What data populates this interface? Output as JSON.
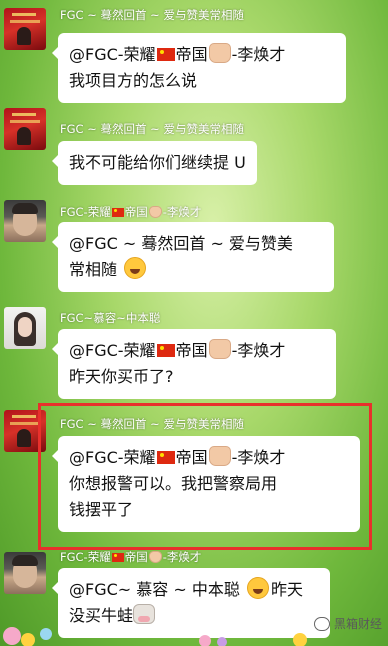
{
  "messages": [
    {
      "sender": "FGC ~ 蓦然回首 ~ 爱与赞美常相随",
      "lines": [
        "@FGC-荣耀",
        "帝国",
        "-李焕才",
        "我项目方的怎么说"
      ]
    },
    {
      "sender": "FGC ~ 蓦然回首 ~ 爱与赞美常相随",
      "text": "我不可能给你们继续提 U"
    },
    {
      "sender_a": "FGC-荣耀",
      "sender_b": "帝国",
      "sender_c": "-李焕才",
      "lines": [
        "@FGC ~ 蓦然回首 ~ 爱与赞美",
        "常相随"
      ]
    },
    {
      "sender": "FGC~慕容~中本聪",
      "lines": [
        "@FGC-荣耀",
        "帝国",
        "-李焕才",
        "昨天你买币了?"
      ]
    },
    {
      "sender": "FGC ~ 蓦然回首 ~ 爱与赞美常相随",
      "lines": [
        "@FGC-荣耀",
        "帝国",
        "-李焕才",
        "你想报警可以。我把警察局用",
        "钱摆平了"
      ]
    },
    {
      "sender_a": "FGC-荣耀",
      "sender_b": "帝国",
      "sender_c": "-李焕才",
      "lines": [
        "@FGC~ 慕容 ~ 中本聪",
        "昨天",
        "没买牛蛙"
      ]
    }
  ],
  "watermark": "黑箱财经",
  "colors": {
    "highlight": "#e8302c",
    "bubble": "#ffffff"
  }
}
